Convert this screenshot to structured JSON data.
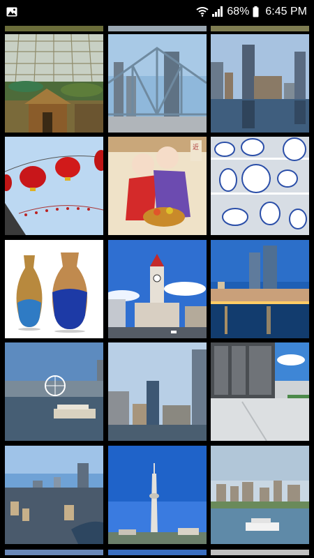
{
  "status_bar": {
    "left_icon": "image-gallery-icon",
    "wifi_icon": "wifi-icon",
    "signal_icon": "cell-signal-icon",
    "battery_percent": "68%",
    "battery_icon": "battery-icon",
    "time": "6:45 PM"
  },
  "gallery": {
    "photos": [
      {
        "subject": "glass-dome-garden"
      },
      {
        "subject": "steel-bridge-skyscrapers"
      },
      {
        "subject": "river-skyline-reflection"
      },
      {
        "subject": "red-lanterns"
      },
      {
        "subject": "folk-painting-children"
      },
      {
        "subject": "blue-white-porcelain"
      },
      {
        "subject": "two-vases"
      },
      {
        "subject": "clock-tower"
      },
      {
        "subject": "night-waterfront"
      },
      {
        "subject": "ferris-wheel-river"
      },
      {
        "subject": "city-tower-river"
      },
      {
        "subject": "modern-building-plaza"
      },
      {
        "subject": "aerial-city"
      },
      {
        "subject": "tv-tower"
      },
      {
        "subject": "river-boat-skyline"
      }
    ]
  },
  "colors": {
    "background": "#000000",
    "status_text": "#ffffff"
  }
}
